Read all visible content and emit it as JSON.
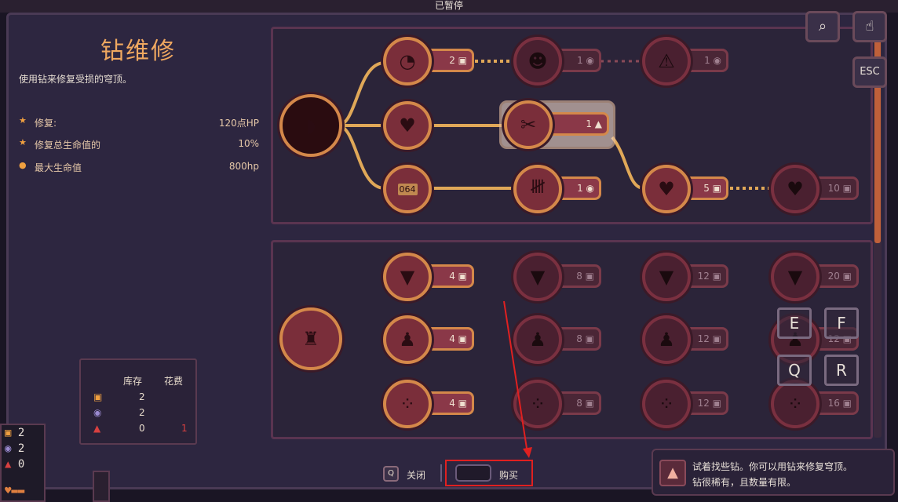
{
  "status": {
    "paused": "已暂停"
  },
  "upgrade": {
    "title": "钻维修",
    "description": "使用钻来修复受损的穹顶。",
    "stats": [
      {
        "icon": "star-icon",
        "label": "修复:",
        "value": "120点HP"
      },
      {
        "icon": "star-icon",
        "label": "修复总生命值的",
        "value": "10%"
      },
      {
        "icon": "dot-icon",
        "label": "最大生命值",
        "value": "800hp"
      }
    ]
  },
  "tree1": {
    "nodes": [
      {
        "cost": "2",
        "currency": "iron"
      },
      {
        "cost": "1",
        "currency": "water"
      },
      {
        "cost": "1",
        "currency": "water"
      },
      {
        "cost": "1",
        "currency": "cobalt"
      },
      {
        "cost": "1",
        "currency": "water"
      },
      {
        "cost": "5",
        "currency": "iron"
      },
      {
        "cost": "10",
        "currency": "iron"
      }
    ],
    "badge_text": "064"
  },
  "tree2": {
    "rows": [
      [
        "4",
        "8",
        "12",
        "20"
      ],
      [
        "4",
        "8",
        "12",
        "12"
      ],
      [
        "4",
        "8",
        "12",
        "16"
      ]
    ]
  },
  "inventory": {
    "header_stock": "库存",
    "header_cost": "花费",
    "rows": [
      {
        "stock": "2",
        "cost": ""
      },
      {
        "stock": "2",
        "cost": ""
      },
      {
        "stock": "0",
        "cost": "1"
      }
    ]
  },
  "corner_resources": [
    "2",
    "2",
    "0"
  ],
  "buttons": {
    "close": "关闭",
    "buy": "购买",
    "close_key": "Q"
  },
  "tooltip": {
    "line1": "试着找些钻。你可以用钻来修复穹顶。",
    "line2": "钻很稀有，且数量有限。"
  },
  "top_buttons": {
    "search_icon": "search-icon",
    "pointer_icon": "hand-pointer-icon",
    "esc": "ESC"
  },
  "key_hints": [
    "E",
    "F",
    "Q",
    "R"
  ],
  "colors": {
    "accent": "#d4884a",
    "highlight_box": "#e02020",
    "title": "#f0a860"
  }
}
